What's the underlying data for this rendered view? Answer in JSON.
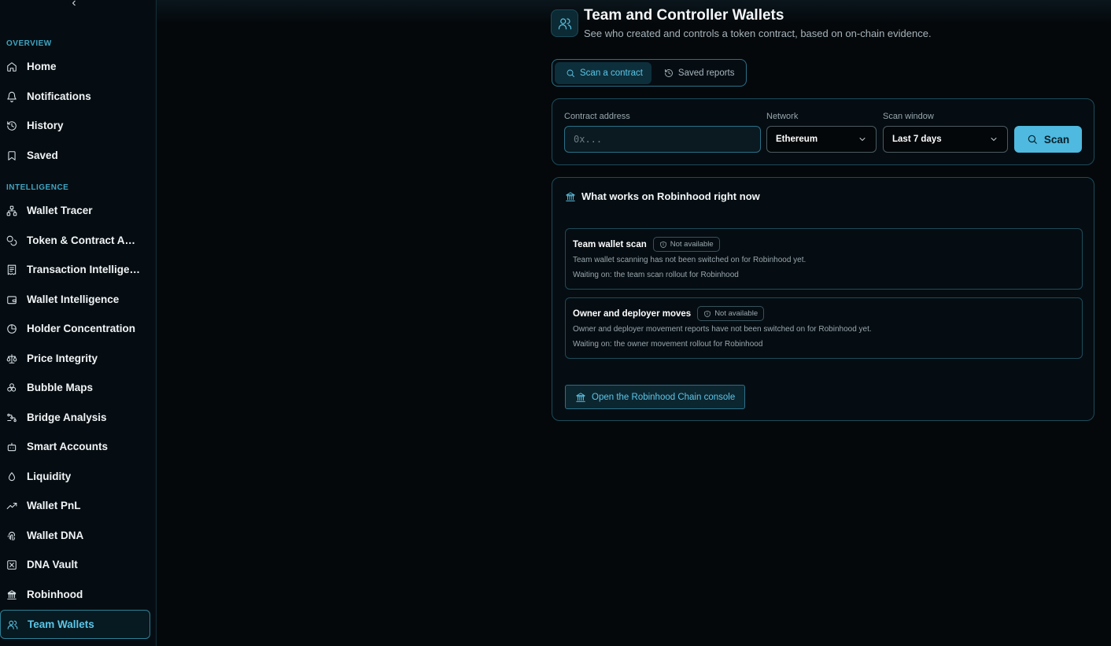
{
  "sidebar": {
    "collapse_glyph": "‹",
    "sections": [
      {
        "label": "OVERVIEW",
        "items": [
          {
            "label": "Home",
            "icon": "home-icon"
          },
          {
            "label": "Notifications",
            "icon": "bell-icon"
          },
          {
            "label": "History",
            "icon": "history-icon"
          },
          {
            "label": "Saved",
            "icon": "bookmark-icon"
          }
        ]
      },
      {
        "label": "INTELLIGENCE",
        "items": [
          {
            "label": "Wallet Tracer",
            "icon": "network-icon"
          },
          {
            "label": "Token & Contract Anal...",
            "icon": "coins-icon"
          },
          {
            "label": "Transaction Intelligen...",
            "icon": "receipt-icon"
          },
          {
            "label": "Wallet Intelligence",
            "icon": "wallet-icon"
          },
          {
            "label": "Holder Concentration",
            "icon": "pie-chart-icon"
          },
          {
            "label": "Price Integrity",
            "icon": "scale-icon"
          },
          {
            "label": "Bubble Maps",
            "icon": "bubbles-icon"
          },
          {
            "label": "Bridge Analysis",
            "icon": "bridge-icon"
          },
          {
            "label": "Smart Accounts",
            "icon": "bot-icon"
          },
          {
            "label": "Liquidity",
            "icon": "droplets-icon"
          },
          {
            "label": "Wallet PnL",
            "icon": "trending-up-icon"
          },
          {
            "label": "Wallet DNA",
            "icon": "fingerprint-icon"
          },
          {
            "label": "DNA Vault",
            "icon": "vault-icon"
          },
          {
            "label": "Robinhood",
            "icon": "landmark-icon"
          },
          {
            "label": "Team Wallets",
            "icon": "users-icon",
            "active": true
          }
        ]
      }
    ]
  },
  "header": {
    "title": "Team and Controller Wallets",
    "subtitle": "See who created and controls a token contract, based on on-chain evidence.",
    "icon": "users-icon"
  },
  "tabs": [
    {
      "label": "Scan a contract",
      "icon": "search-icon",
      "active": true
    },
    {
      "label": "Saved reports",
      "icon": "history-icon",
      "active": false
    }
  ],
  "scan_form": {
    "address_label": "Contract address",
    "address_value": "",
    "address_placeholder": "0x...",
    "network_label": "Network",
    "network_value": "Ethereum",
    "window_label": "Scan window",
    "window_value": "Last 7 days",
    "scan_label": "Scan"
  },
  "info": {
    "title": "What works on Robinhood right now",
    "features": [
      {
        "name": "Team wallet scan",
        "badge": "Not available",
        "description": "Team wallet scanning has not been switched on for Robinhood yet.",
        "waiting": "Waiting on: the team scan rollout for Robinhood"
      },
      {
        "name": "Owner and deployer moves",
        "badge": "Not available",
        "description": "Owner and deployer movement reports have not been switched on for Robinhood yet.",
        "waiting": "Waiting on: the owner movement rollout for Robinhood"
      }
    ],
    "console_label": "Open the Robinhood Chain console"
  },
  "colors": {
    "accent": "#5cc6e8",
    "background": "#04080b",
    "scan_button": "#4fb9df"
  }
}
